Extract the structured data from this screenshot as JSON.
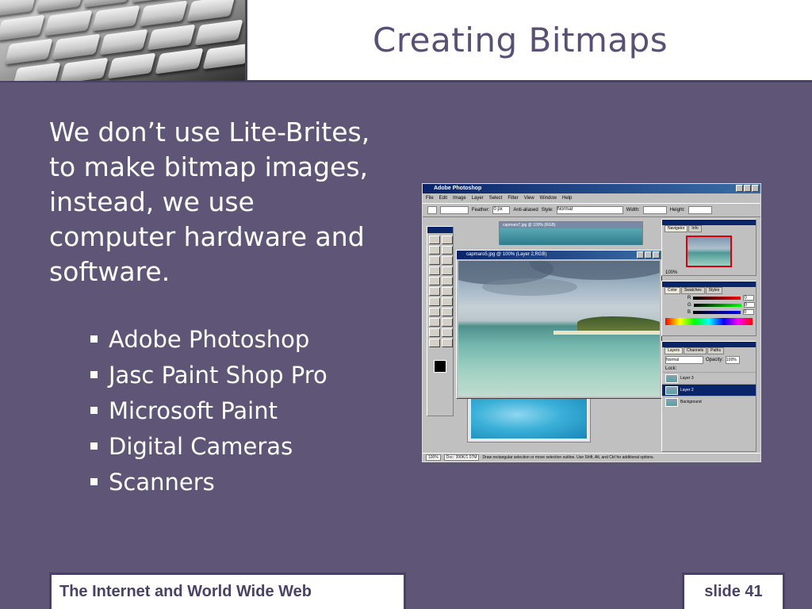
{
  "slide": {
    "title": "Creating Bitmaps",
    "body_text": "We don’t use Lite-Brites, to make bitmap images, instead, we use computer hardware and software.",
    "bullets": [
      "Adobe Photoshop",
      "Jasc Paint Shop Pro",
      "Microsoft Paint",
      "Digital Cameras",
      "Scanners"
    ]
  },
  "footer": {
    "course": "The Internet and World Wide Web",
    "slide_number": "slide 41"
  },
  "photoshop_screenshot": {
    "window_title": "Adobe Photoshop",
    "menu": [
      "File",
      "Edit",
      "Image",
      "Layer",
      "Select",
      "Filter",
      "View",
      "Window",
      "Help"
    ],
    "options": {
      "feather_label": "Feather:",
      "feather_value": "0 px",
      "anti_aliased": "Anti-aliased",
      "style_label": "Style:",
      "style_value": "Normal",
      "width_label": "Width:",
      "height_label": "Height:"
    },
    "back_document_title": "capmaro7.jpg @ 100% (RGB)",
    "front_document_title": "capmaro5.jpg @ 100% (Layer 2,RGB)",
    "navigator_tabs": [
      "Navigator",
      "Info"
    ],
    "zoom": "100%",
    "color_tabs": [
      "Color",
      "Swatches",
      "Styles"
    ],
    "color_channels": [
      {
        "label": "R",
        "value": "0"
      },
      {
        "label": "G",
        "value": "0"
      },
      {
        "label": "B",
        "value": "0"
      }
    ],
    "layers_tabs": [
      "Layers",
      "Channels",
      "Paths"
    ],
    "blend_mode": "Normal",
    "opacity_label": "Opacity:",
    "opacity_value": "100%",
    "lock_label": "Lock:",
    "layers": [
      "Layer 3",
      "Layer 2",
      "Background"
    ],
    "status_zoom": "100%",
    "status_doc": "Doc: 390K/1.07M",
    "status_hint": "Draw rectangular selection or move selection outline. Use Shift, Alt, and Ctrl for additional options."
  },
  "colors": {
    "background": "#5f5677",
    "title_text": "#5a5075",
    "footer_text": "#4a4266",
    "body_text": "#ffffff"
  }
}
